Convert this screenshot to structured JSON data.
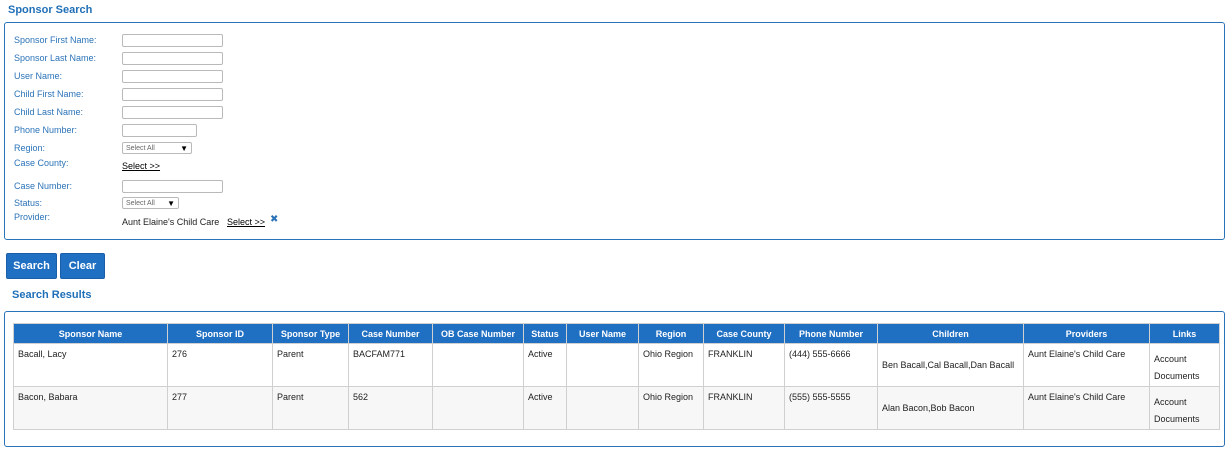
{
  "search": {
    "title": "Sponsor Search",
    "fields": {
      "sponsor_first_name": {
        "label": "Sponsor First Name:",
        "value": ""
      },
      "sponsor_last_name": {
        "label": "Sponsor Last Name:",
        "value": ""
      },
      "user_name": {
        "label": "User Name:",
        "value": ""
      },
      "child_first_name": {
        "label": "Child First Name:",
        "value": ""
      },
      "child_last_name": {
        "label": "Child Last Name:",
        "value": ""
      },
      "phone_number": {
        "label": "Phone Number:",
        "value": ""
      },
      "region": {
        "label": "Region:",
        "selected": "Select All"
      },
      "case_county": {
        "label": "Case County:",
        "link": "Select >>"
      },
      "case_number": {
        "label": "Case Number:",
        "value": ""
      },
      "status": {
        "label": "Status:",
        "selected": "Select All"
      },
      "provider": {
        "label": "Provider:",
        "value": "Aunt Elaine's Child Care",
        "link": "Select >>"
      }
    }
  },
  "buttons": {
    "search": "Search",
    "clear": "Clear"
  },
  "results": {
    "title": "Search Results",
    "columns": [
      "Sponsor Name",
      "Sponsor ID",
      "Sponsor Type",
      "Case Number",
      "OB Case Number",
      "Status",
      "User Name",
      "Region",
      "Case County",
      "Phone Number",
      "Children",
      "Providers",
      "Links"
    ],
    "rows": [
      {
        "sponsor_name": "Bacall, Lacy",
        "sponsor_id": "276",
        "sponsor_type": "Parent",
        "case_number": "BACFAM771",
        "ob_case_number": "",
        "status": "Active",
        "user_name": "",
        "region": "Ohio Region",
        "case_county": "FRANKLIN",
        "phone": "(444) 555-6666",
        "children": "Ben Bacall,Cal Bacall,Dan Bacall",
        "providers": "Aunt Elaine's Child Care",
        "link_account": "Account",
        "link_documents": "Documents"
      },
      {
        "sponsor_name": "Bacon, Babara",
        "sponsor_id": "277",
        "sponsor_type": "Parent",
        "case_number": "562",
        "ob_case_number": "",
        "status": "Active",
        "user_name": "",
        "region": "Ohio Region",
        "case_county": "FRANKLIN",
        "phone": "(555) 555-5555",
        "children": "Alan Bacon,Bob Bacon",
        "providers": "Aunt Elaine's Child Care",
        "link_account": "Account",
        "link_documents": "Documents"
      }
    ]
  },
  "icons": {
    "remove_provider": "close-x-icon",
    "dropdown": "chevron-down-icon"
  },
  "colors": {
    "accent": "#1f6fc2",
    "label": "#2b73b8",
    "border": "#2b73b8"
  }
}
